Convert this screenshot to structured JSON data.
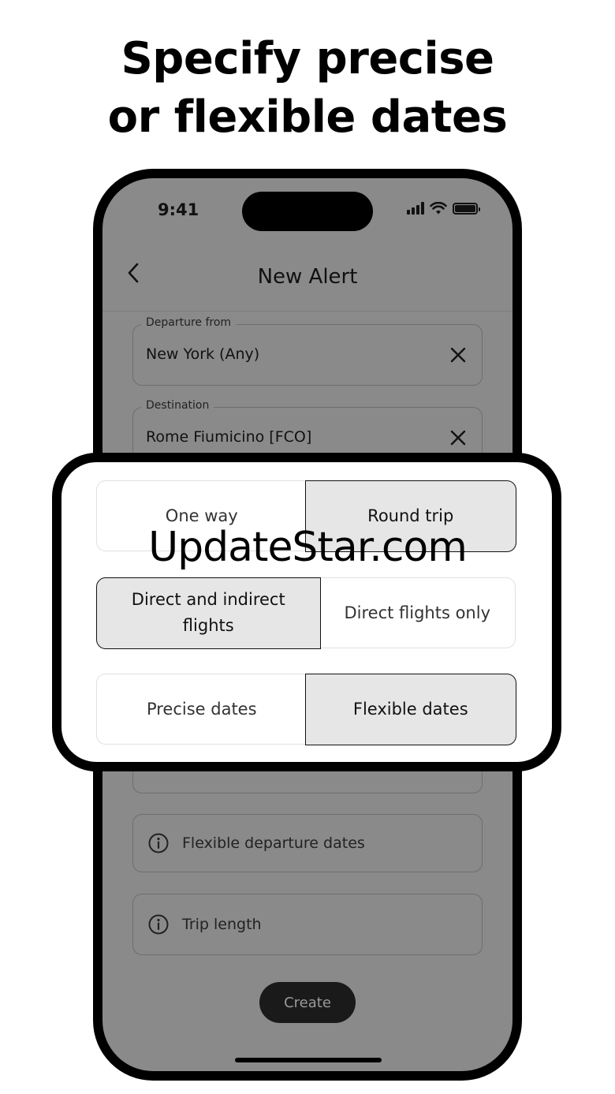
{
  "headline": {
    "line1": "Specify precise",
    "line2": "or flexible dates"
  },
  "status_bar": {
    "time": "9:41"
  },
  "nav": {
    "title": "New Alert"
  },
  "form": {
    "departure": {
      "label": "Departure from",
      "value": "New York (Any)"
    },
    "destination": {
      "label": "Destination",
      "value": "Rome Fiumicino [FCO]"
    },
    "flexible_departure_label": "Flexible departure dates",
    "trip_length_label": "Trip length",
    "create_label": "Create"
  },
  "options": {
    "trip_type": {
      "left": "One way",
      "right": "Round trip",
      "selected": "right"
    },
    "stops": {
      "left": "Direct and indirect flights",
      "right": "Direct flights only",
      "selected": "left"
    },
    "dates": {
      "left": "Precise dates",
      "right": "Flexible dates",
      "selected": "right"
    }
  },
  "watermark": "UpdateStar.com",
  "icons": [
    "back-chevron-icon",
    "clear-icon",
    "info-icon",
    "signal-icon",
    "wifi-icon",
    "battery-icon"
  ]
}
